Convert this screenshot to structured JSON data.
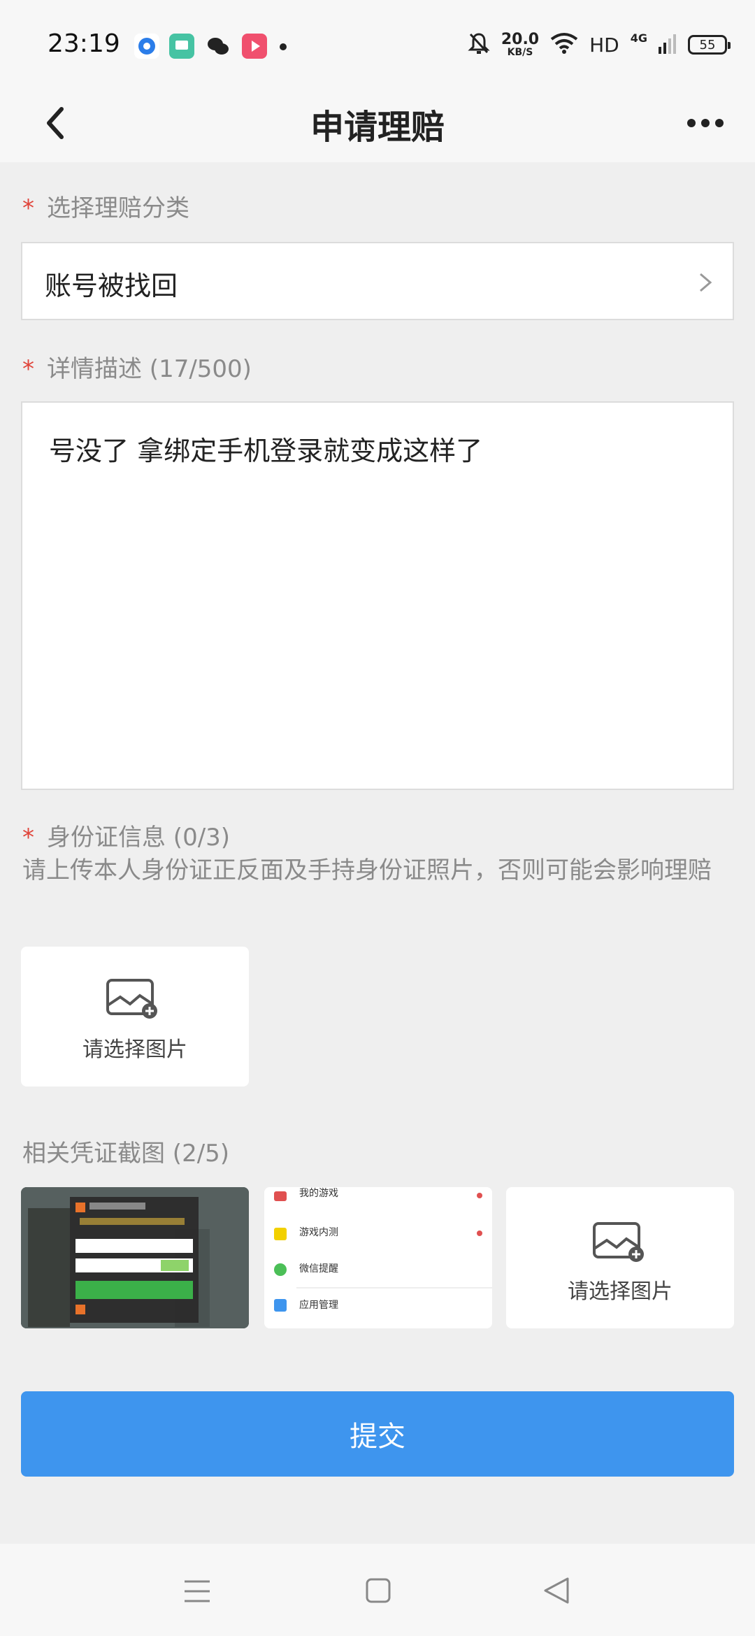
{
  "status_bar": {
    "time": "23:19",
    "net_speed_value": "20.0",
    "net_speed_unit": "KB/S",
    "hd": "HD",
    "network": "4G",
    "battery": "55"
  },
  "header": {
    "title": "申请理赔"
  },
  "category": {
    "required_mark": "*",
    "label": "选择理赔分类",
    "value": "账号被找回"
  },
  "description": {
    "required_mark": "*",
    "label": "详情描述 (17/500)",
    "text": "号没了 拿绑定手机登录就变成这样了"
  },
  "id_info": {
    "required_mark": "*",
    "label": "身份证信息 (0/3)",
    "hint": "请上传本人身份证正反面及手持身份证照片，否则可能会影响理赔",
    "upload_label": "请选择图片"
  },
  "evidence": {
    "label": "相关凭证截图 (2/5)",
    "upload_label": "请选择图片",
    "screenshot2_items": [
      "我的游戏",
      "游戏内测",
      "微信提醒",
      "应用管理"
    ]
  },
  "submit": {
    "label": "提交"
  },
  "colors": {
    "accent": "#3e95ee",
    "required": "#e0443a",
    "background": "#efefef"
  }
}
